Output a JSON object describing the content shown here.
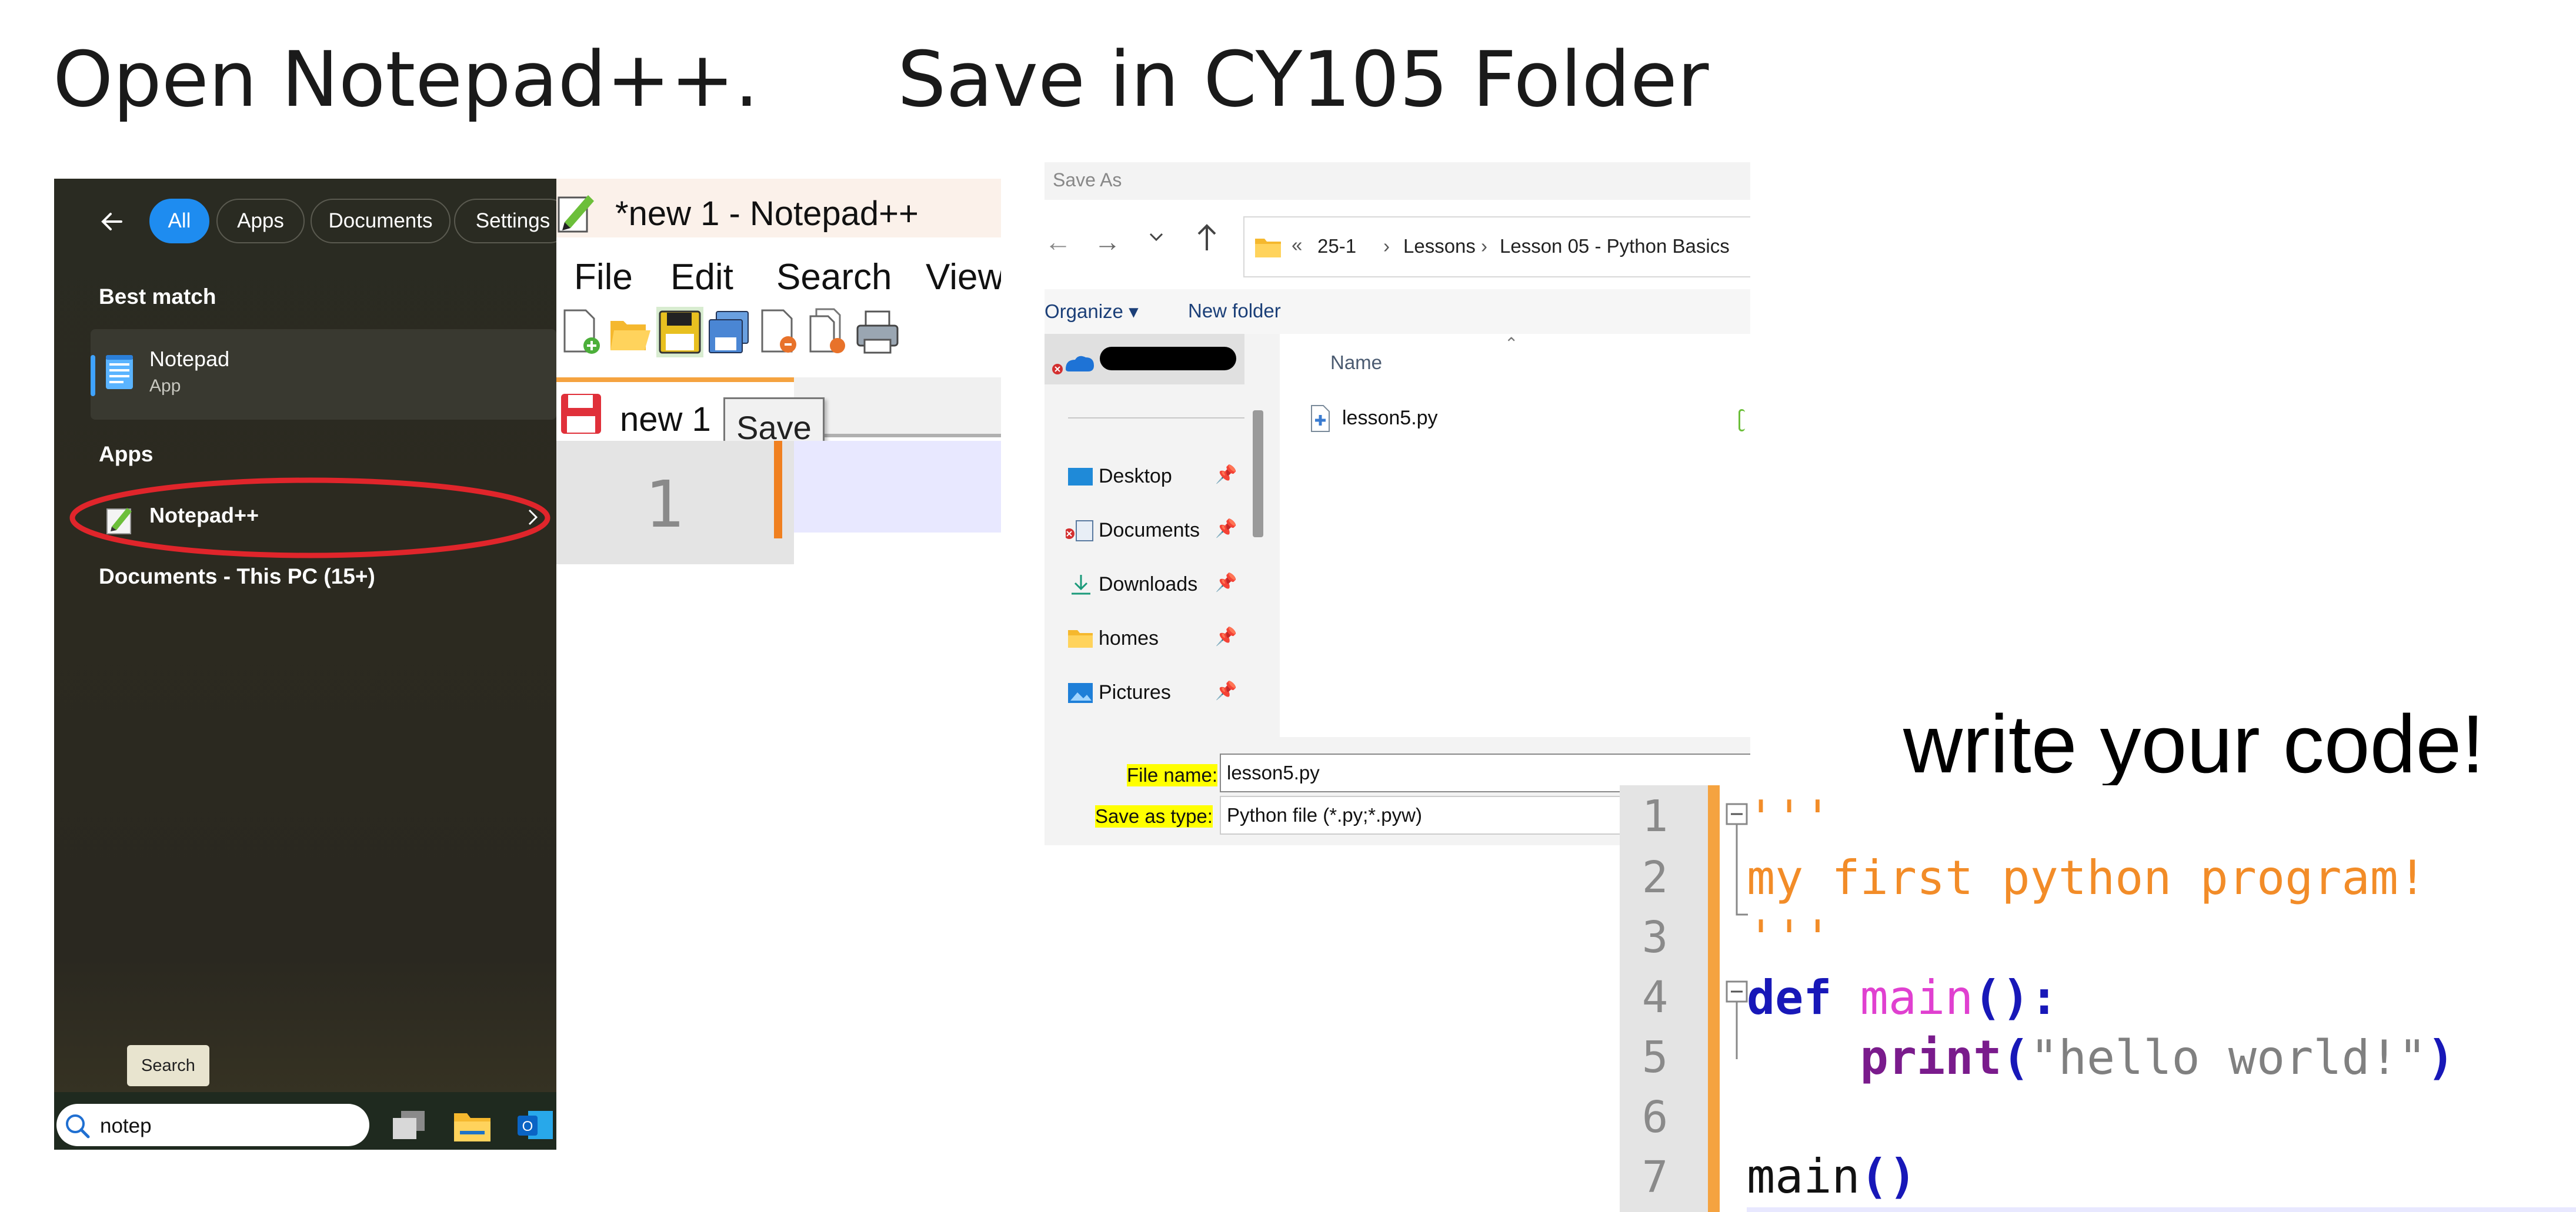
{
  "headings": {
    "open": "Open Notepad++.",
    "save": "Save in CY105 Folder",
    "write": "write your code!"
  },
  "start_menu": {
    "filters": [
      "All",
      "Apps",
      "Documents",
      "Settings"
    ],
    "active_filter": "All",
    "best_match_label": "Best match",
    "best_match": {
      "name": "Notepad",
      "type": "App"
    },
    "apps_label": "Apps",
    "app_item": "Notepad++",
    "documents_label": "Documents - This PC (15+)",
    "search_tooltip": "Search",
    "search_value": "notep",
    "highlight_color": "#e0252b"
  },
  "notepadpp": {
    "title": "*new 1 - Notepad++",
    "menu": [
      "File",
      "Edit",
      "Search",
      "View"
    ],
    "tab_label": "new 1",
    "tooltip": "Save",
    "line_number": "1"
  },
  "save_dialog": {
    "title": "Save As",
    "breadcrumb": [
      "25-1",
      "Lessons",
      "Lesson 05 - Python Basics"
    ],
    "organize_label": "Organize",
    "new_folder_label": "New folder",
    "column_name": "Name",
    "file": "lesson5.py",
    "nav_items": [
      {
        "label": "Desktop",
        "icon": "desktop-icon"
      },
      {
        "label": "Documents",
        "icon": "documents-icon"
      },
      {
        "label": "Downloads",
        "icon": "downloads-icon"
      },
      {
        "label": "homes",
        "icon": "folder-icon"
      },
      {
        "label": "Pictures",
        "icon": "pictures-icon"
      }
    ],
    "file_name_label": "File name:",
    "file_name_value": "lesson5.py",
    "save_type_label": "Save as type:",
    "save_type_value": "Python file (*.py;*.pyw)"
  },
  "code_editor": {
    "line_numbers": [
      "1",
      "2",
      "3",
      "4",
      "5",
      "6",
      "7"
    ],
    "docstring_open": "'''",
    "docstring_text": "my first python program!",
    "docstring_close": "'''",
    "def_keyword": "def",
    "func_name": "main",
    "def_parens": "():",
    "print_keyword": "print",
    "print_open": "(",
    "print_string": "\"hello world!\"",
    "print_close": ")",
    "call_name": "main",
    "call_parens": "()",
    "colors": {
      "string": "#f28c28",
      "keyword": "#1818b8",
      "function": "#e040d0",
      "print": "#7a1b8c",
      "text_string": "#808080"
    }
  }
}
